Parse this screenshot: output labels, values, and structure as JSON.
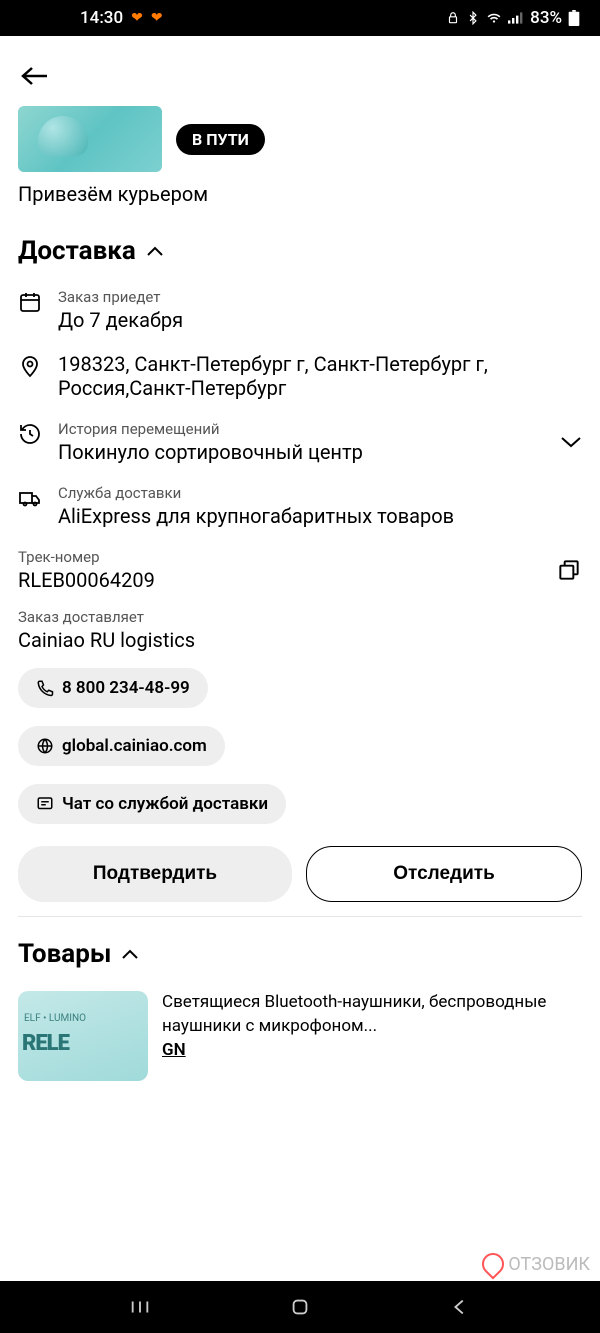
{
  "status_bar": {
    "time": "14:30",
    "battery": "83%"
  },
  "order": {
    "status_badge": "В ПУТИ",
    "delivery_method": "Привезём курьером"
  },
  "delivery": {
    "title": "Доставка",
    "arrival_label": "Заказ приедет",
    "arrival_value": "До 7 декабря",
    "address": "198323, Санкт-Петербург г, Санкт-Петербург г, Россия,Санкт-Петербург",
    "history_label": "История перемещений",
    "history_value": "Покинуло сортировочный центр",
    "service_label": "Служба доставки",
    "service_value": "AliExpress для крупногабаритных товаров",
    "track_label": "Трек-номер",
    "track_value": "RLEB00064209",
    "carrier_label": "Заказ доставляет",
    "carrier_value": "Cainiao RU logistics",
    "phone": "8 800 234-48-99",
    "website": "global.cainiao.com",
    "chat": "Чат со службой доставки",
    "confirm_btn": "Подтвердить",
    "track_btn": "Отследить"
  },
  "goods": {
    "title": "Товары",
    "item_title": "Светящиеся Bluetooth-наушники, беспроводные наушники с микрофоном...",
    "variant": "GN"
  },
  "watermark": "ОТЗОВИК"
}
